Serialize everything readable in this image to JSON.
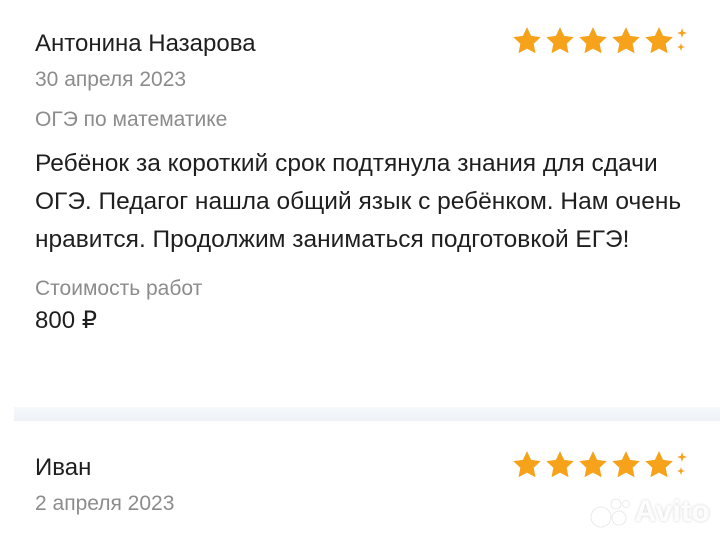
{
  "reviews": [
    {
      "author": "Антонина Назарова",
      "date": "30 апреля 2023",
      "subject": "ОГЭ по математике",
      "text": "Ребёнок за короткий срок подтянула знания для сдачи ОГЭ. Педагог нашла общий язык с ребёнком. Нам очень нравится. Продолжим заниматься подготовкой ЕГЭ!",
      "cost_label": "Стоимость работ",
      "cost_value": "800 ₽",
      "rating": 5
    },
    {
      "author": "Иван",
      "date": "2 апреля 2023",
      "rating": 5
    }
  ],
  "watermark": "Avito",
  "colors": {
    "star": "#f7a21b",
    "text_primary": "#1f1f1f",
    "text_secondary": "#8c8c8c"
  },
  "icons": {
    "star": "star-icon",
    "sparkle": "sparkle-icon",
    "logo": "avito-logo-icon"
  }
}
